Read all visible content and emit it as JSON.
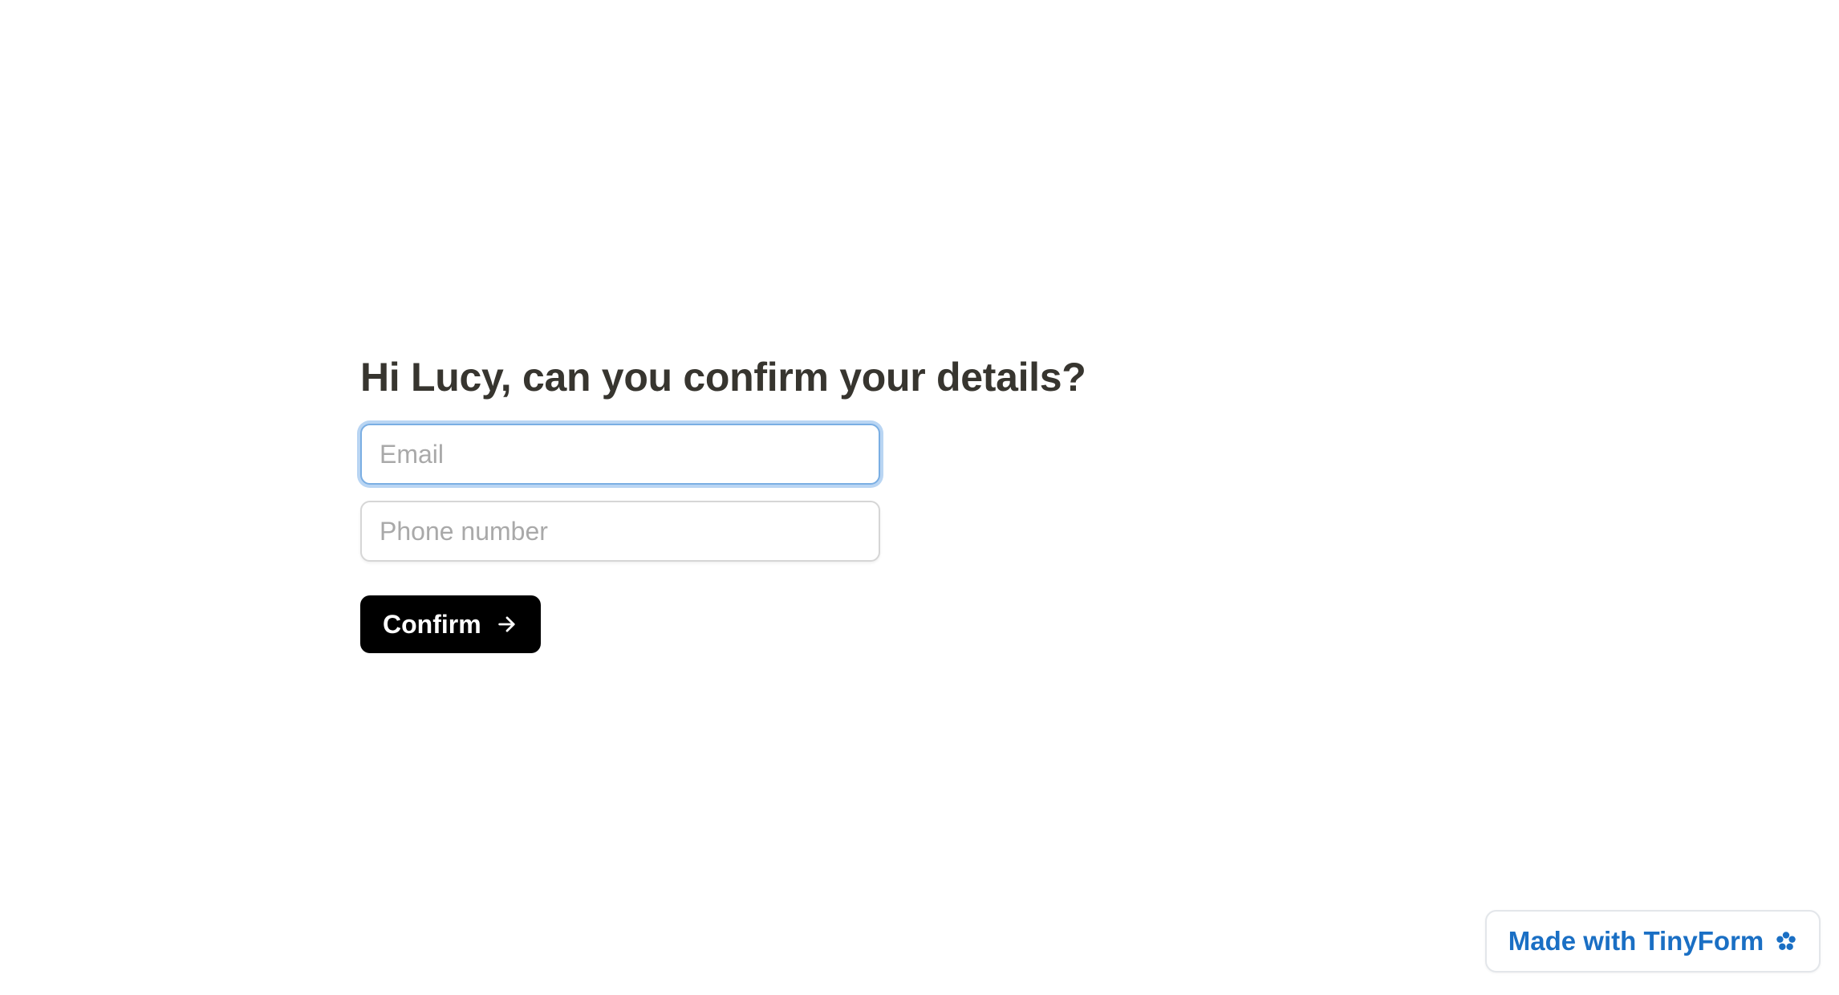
{
  "form": {
    "title": "Hi Lucy, can you confirm your details?",
    "email": {
      "placeholder": "Email",
      "value": ""
    },
    "phone": {
      "placeholder": "Phone number",
      "value": ""
    },
    "confirm_label": "Confirm",
    "confirm_icon": "arrow-right-icon"
  },
  "badge": {
    "label": "Made with TinyForm",
    "icon": "flower-icon",
    "color": "#1a6fc4"
  },
  "colors": {
    "title": "#37352f",
    "button_bg": "#000000",
    "focus_ring": "#b9d5f3"
  }
}
